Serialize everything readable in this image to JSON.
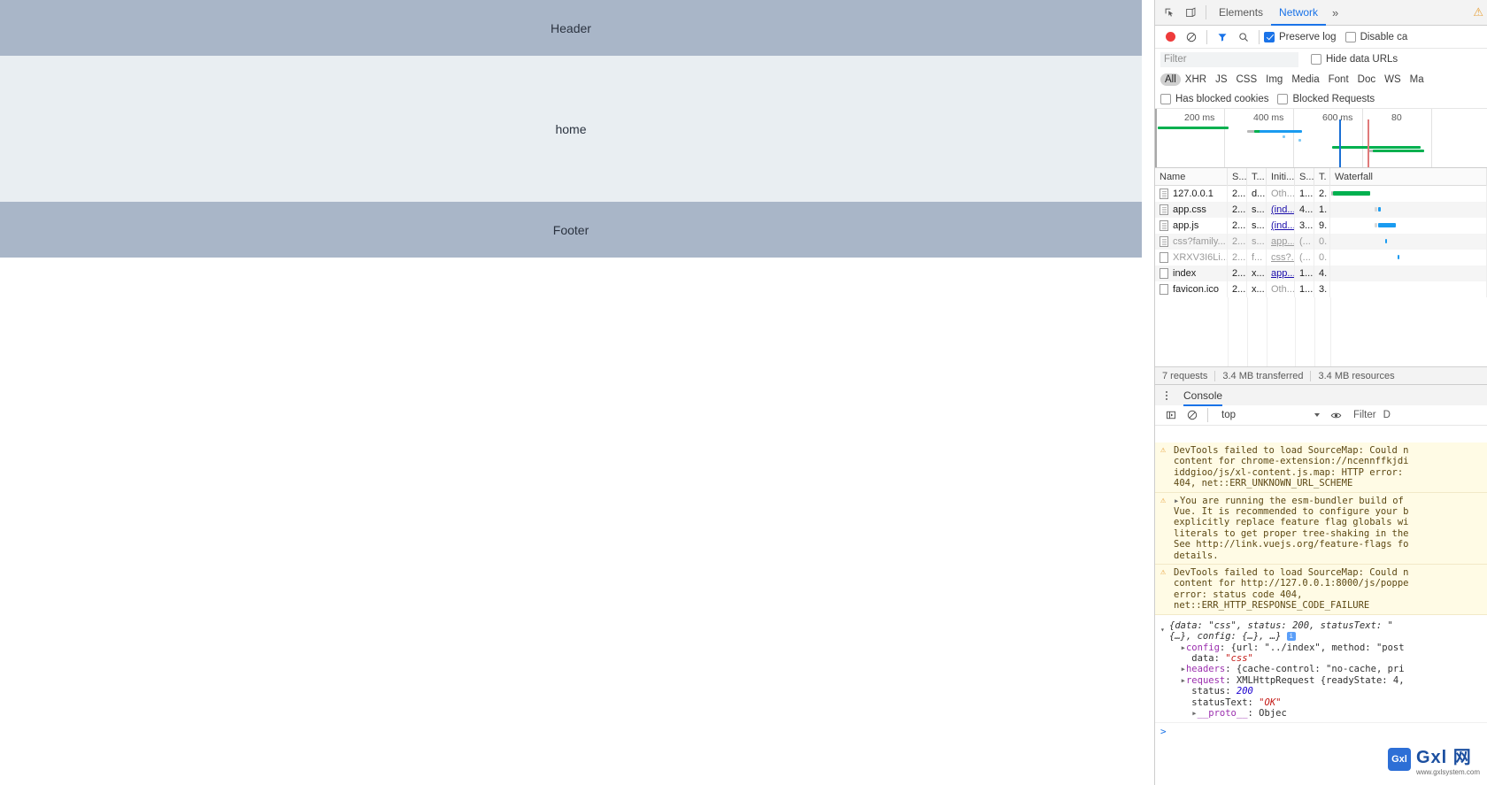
{
  "page": {
    "header_label": "Header",
    "main_label": "home",
    "footer_label": "Footer"
  },
  "devtools": {
    "tabs": [
      {
        "label": "Elements",
        "active": false
      },
      {
        "label": "Network",
        "active": true
      }
    ],
    "more_tabs_glyph": "»",
    "warning_badge": "⚠",
    "network_toolbar": {
      "preserve_log_label": "Preserve log",
      "preserve_log_checked": true,
      "disable_cache_label": "Disable ca",
      "disable_cache_checked": false
    },
    "filter": {
      "placeholder": "Filter",
      "value": "",
      "hide_data_urls_label": "Hide data URLs",
      "hide_data_urls_checked": false
    },
    "type_filters": [
      "All",
      "XHR",
      "JS",
      "CSS",
      "Img",
      "Media",
      "Font",
      "Doc",
      "WS",
      "Ma"
    ],
    "type_filter_selected": "All",
    "blocked_row": {
      "has_blocked_cookies_label": "Has blocked cookies",
      "has_blocked_cookies_checked": false,
      "blocked_requests_label": "Blocked Requests",
      "blocked_requests_checked": false
    },
    "overview": {
      "ticks": [
        "200 ms",
        "400 ms",
        "600 ms",
        "80"
      ]
    },
    "table": {
      "columns": [
        "Name",
        "S...",
        "T...",
        "Initi...",
        "S...",
        "T.",
        "Waterfall"
      ],
      "rows": [
        {
          "name": "127.0.0.1",
          "status": "2...",
          "type": "d...",
          "initiator": "Oth...",
          "size": "1...",
          "time": "2.",
          "initiator_link": false,
          "dim": false,
          "icon": "doc-icon"
        },
        {
          "name": "app.css",
          "status": "2...",
          "type": "s...",
          "initiator": "(ind...",
          "size": "4...",
          "time": "1.",
          "initiator_link": true,
          "dim": false,
          "icon": "doc-icon"
        },
        {
          "name": "app.js",
          "status": "2...",
          "type": "s...",
          "initiator": "(ind...",
          "size": "3...",
          "time": "9.",
          "initiator_link": true,
          "dim": false,
          "icon": "doc-icon"
        },
        {
          "name": "css?family...",
          "status": "2...",
          "type": "s...",
          "initiator": "app...",
          "size": "(...",
          "time": "0.",
          "initiator_link": true,
          "dim": true,
          "icon": "doc-icon"
        },
        {
          "name": "XRXV3I6Li...",
          "status": "2...",
          "type": "f...",
          "initiator": "css?...",
          "size": "(...",
          "time": "0.",
          "initiator_link": true,
          "dim": true,
          "icon": "file-icon"
        },
        {
          "name": "index",
          "status": "2...",
          "type": "x...",
          "initiator": "app...",
          "size": "1...",
          "time": "4.",
          "initiator_link": true,
          "dim": false,
          "icon": "file-icon"
        },
        {
          "name": "favicon.ico",
          "status": "2...",
          "type": "x...",
          "initiator": "Oth...",
          "size": "1...",
          "time": "3.",
          "initiator_link": false,
          "dim": false,
          "icon": "file-icon"
        }
      ]
    },
    "net_status": {
      "requests": "7 requests",
      "transferred": "3.4 MB transferred",
      "resources": "3.4 MB resources"
    },
    "drawer": {
      "tab_label": "Console",
      "context": "top",
      "filter_label": "Filter",
      "prompt_glyph": ">"
    },
    "console_messages": [
      {
        "kind": "warning",
        "lines": [
          "DevTools failed to load SourceMap: Could n",
          "content for chrome-extension://ncennffkjdi",
          "iddgioo/js/xl-content.js.map: HTTP error: ",
          "404, net::ERR_UNKNOWN_URL_SCHEME"
        ]
      },
      {
        "kind": "warning",
        "expandable": true,
        "lines": [
          "You are running the esm-bundler build of ",
          "Vue. It is recommended to configure your b",
          "explicitly replace feature flag globals wi",
          "literals to get proper tree-shaking in the",
          "See http://link.vuejs.org/feature-flags fo",
          "details."
        ]
      },
      {
        "kind": "warning",
        "lines": [
          "DevTools failed to load SourceMap: Could n",
          "content for http://127.0.0.1:8000/js/poppe",
          "error: status code 404,",
          "net::ERR_HTTP_RESPONSE_CODE_FAILURE"
        ]
      }
    ],
    "console_object": {
      "summary_line1": "{data: \"css\", status: 200, statusText: \"",
      "summary_line2": "{…}, config: {…}, …}",
      "props": [
        {
          "tri": true,
          "key": "config",
          "value": "{url: \"../index\", method: \"post"
        },
        {
          "tri": false,
          "key": "data",
          "value": "\"css\""
        },
        {
          "tri": true,
          "key": "headers",
          "value": "{cache-control: \"no-cache, pri"
        },
        {
          "tri": true,
          "key": "request",
          "value": "XMLHttpRequest {readyState: 4,"
        },
        {
          "tri": false,
          "key": "status",
          "value": "200"
        },
        {
          "tri": false,
          "key": "statusText",
          "value": "\"OK\""
        },
        {
          "tri": true,
          "key": "__proto__",
          "value": ": Objec"
        }
      ]
    },
    "colors": {
      "accent": "#1a73e8",
      "record": "#ee3b3b",
      "waterfall_green": "#00b04f",
      "waterfall_blue": "#1a9bf0",
      "warning": "#e8a33d",
      "band": "#a9b6c8",
      "band_light": "#e9eef2"
    }
  },
  "watermark": {
    "logo": "Gxl",
    "main": "Gxl 网",
    "sub": "www.gxlsystem.com"
  }
}
